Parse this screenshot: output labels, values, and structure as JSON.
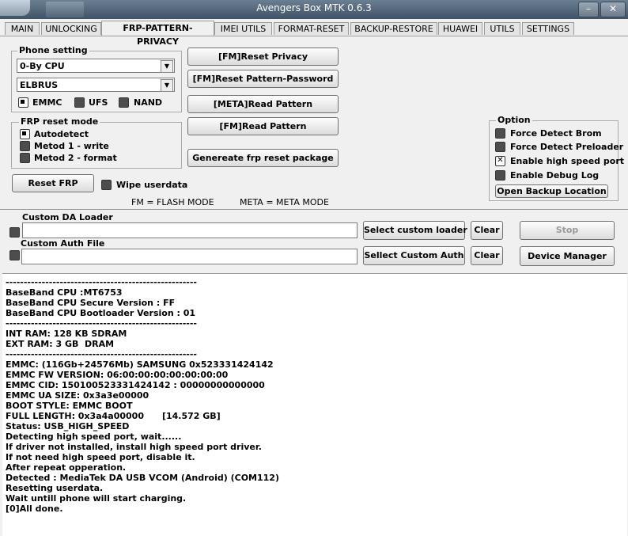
{
  "window": {
    "title": "Avengers Box MTK 0.6.3",
    "minimize_symbol": "–",
    "close_symbol": "✕"
  },
  "tabs": [
    {
      "label": "MAIN",
      "active": false
    },
    {
      "label": "UNLOCKING",
      "active": false
    },
    {
      "label": "FRP-PATTERN-PRIVACY",
      "active": true
    },
    {
      "label": "IMEI UTILS",
      "active": false
    },
    {
      "label": "FORMAT-RESET",
      "active": false
    },
    {
      "label": "BACKUP-RESTORE",
      "active": false
    },
    {
      "label": "HUAWEI",
      "active": false
    },
    {
      "label": "UTILS",
      "active": false
    },
    {
      "label": "SETTINGS",
      "active": false
    }
  ],
  "phone_setting": {
    "label": "Phone setting",
    "cpu_combo": "0-By CPU",
    "model_combo": "ELBRUS",
    "storage": [
      {
        "label": "EMMC",
        "checked": true
      },
      {
        "label": "UFS",
        "checked": false
      },
      {
        "label": "NAND",
        "checked": false
      }
    ]
  },
  "frp_reset_mode": {
    "label": "FRP reset mode",
    "options": [
      {
        "label": "Autodetect",
        "checked": true
      },
      {
        "label": "Metod 1 - write",
        "checked": false
      },
      {
        "label": "Metod 2 - format",
        "checked": false
      }
    ]
  },
  "actions": {
    "reset_privacy": "[FM]Reset Privacy",
    "reset_pattern_password": "[FM]Reset Pattern-Password",
    "meta_read_pattern": "[META]Read Pattern",
    "fm_read_pattern": "[FM]Read Pattern",
    "generate_package": "Genereate frp reset package",
    "reset_frp": "Reset FRP",
    "wipe_userdata": "Wipe userdata"
  },
  "legend": {
    "fm": "FM = FLASH MODE",
    "meta": "META = META MODE"
  },
  "option": {
    "label": "Option",
    "items": [
      {
        "label": "Force Detect Brom",
        "checked": false
      },
      {
        "label": "Force Detect Preloader",
        "checked": false
      },
      {
        "label": "Enable high speed port",
        "checked": true
      },
      {
        "label": "Enable Debug Log",
        "checked": false
      }
    ],
    "open_backup": "Open Backup Location"
  },
  "loader": {
    "da_label": "Custom DA Loader",
    "da_value": "",
    "auth_label": "Custom Auth File",
    "auth_value": "",
    "select_loader": "Select custom loader",
    "select_auth": "Sellect Custom Auth",
    "clear": "Clear",
    "stop": "Stop",
    "device_manager": "Device Manager"
  },
  "log_lines": [
    "-----------------------------------------------------",
    "BaseBand CPU :MT6753",
    "BaseBand CPU Secure Version : FF",
    "BaseBand CPU Bootloader Version : 01",
    "-----------------------------------------------------",
    "INT RAM: 128 KB SDRAM",
    "EXT RAM: 3 GB  DRAM",
    "-----------------------------------------------------",
    "EMMC: (116Gb+24576Mb) SAMSUNG 0x523331424142",
    "EMMC FW VERSION: 06:00:00:00:00:00:00:00",
    "EMMC CID: 150100523331424142 : 00000000000000",
    "EMMC UA SIZE: 0x3a3e00000",
    "BOOT STYLE: EMMC BOOT",
    "FULL LENGTH: 0x3a4a00000      [14.572 GB]",
    "Status: USB_HIGH_SPEED",
    "Detecting high speed port, wait......",
    "If driver not installed, install high speed port driver.",
    "If not need high speed port, disable it.",
    "After repeat opperation.",
    "Detected : MediaTek DA USB VCOM (Android) (COM112)",
    "Resetting userdata.",
    "Wait untill phone will start charging.",
    "[0]All done."
  ]
}
